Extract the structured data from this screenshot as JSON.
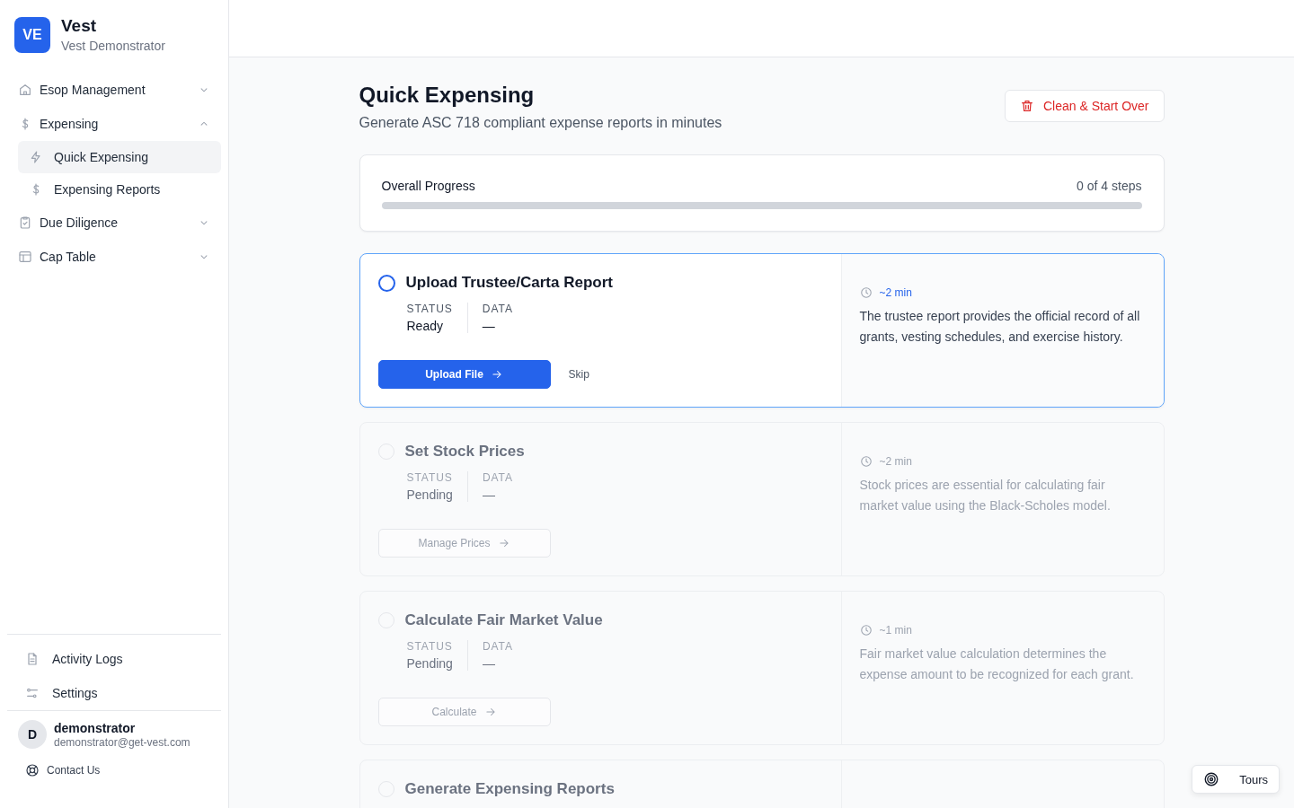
{
  "brand": {
    "logo": "VE",
    "name": "Vest",
    "subtitle": "Vest Demonstrator"
  },
  "nav": [
    {
      "label": "Esop Management",
      "expanded": false
    },
    {
      "label": "Expensing",
      "expanded": true,
      "children": [
        {
          "label": "Quick Expensing",
          "selected": true
        },
        {
          "label": "Expensing Reports",
          "selected": false
        }
      ]
    },
    {
      "label": "Due Diligence",
      "expanded": false
    },
    {
      "label": "Cap Table",
      "expanded": false
    }
  ],
  "footer_nav": [
    {
      "label": "Activity Logs"
    },
    {
      "label": "Settings"
    }
  ],
  "user": {
    "initial": "D",
    "name": "demonstrator",
    "email": "demonstrator@get-vest.com"
  },
  "contact": "Contact Us",
  "page": {
    "title": "Quick Expensing",
    "subtitle": "Generate ASC 718 compliant expense reports in minutes",
    "reset_button": "Clean & Start Over"
  },
  "progress": {
    "label": "Overall Progress",
    "count": "0 of 4 steps",
    "level": 0
  },
  "steps": [
    {
      "title": "Upload Trustee/Carta Report",
      "active": true,
      "status_label": "STATUS",
      "status": "Ready",
      "data_label": "DATA",
      "data": "—",
      "button": "Upload File",
      "disabled": false,
      "skip": "Skip",
      "time": "~2 min",
      "description": "The trustee report provides the official record of all grants, vesting schedules, and exercise history."
    },
    {
      "title": "Set Stock Prices",
      "active": false,
      "status_label": "STATUS",
      "status": "Pending",
      "data_label": "DATA",
      "data": "—",
      "button": "Manage Prices",
      "disabled": true,
      "time": "~2 min",
      "description": "Stock prices are essential for calculating fair market value using the Black-Scholes model."
    },
    {
      "title": "Calculate Fair Market Value",
      "active": false,
      "status_label": "STATUS",
      "status": "Pending",
      "data_label": "DATA",
      "data": "—",
      "button": "Calculate",
      "disabled": true,
      "time": "~1 min",
      "description": "Fair market value calculation determines the expense amount to be recognized for each grant."
    },
    {
      "title": "Generate Expensing Reports",
      "active": false
    }
  ],
  "tours_button": "Tours"
}
